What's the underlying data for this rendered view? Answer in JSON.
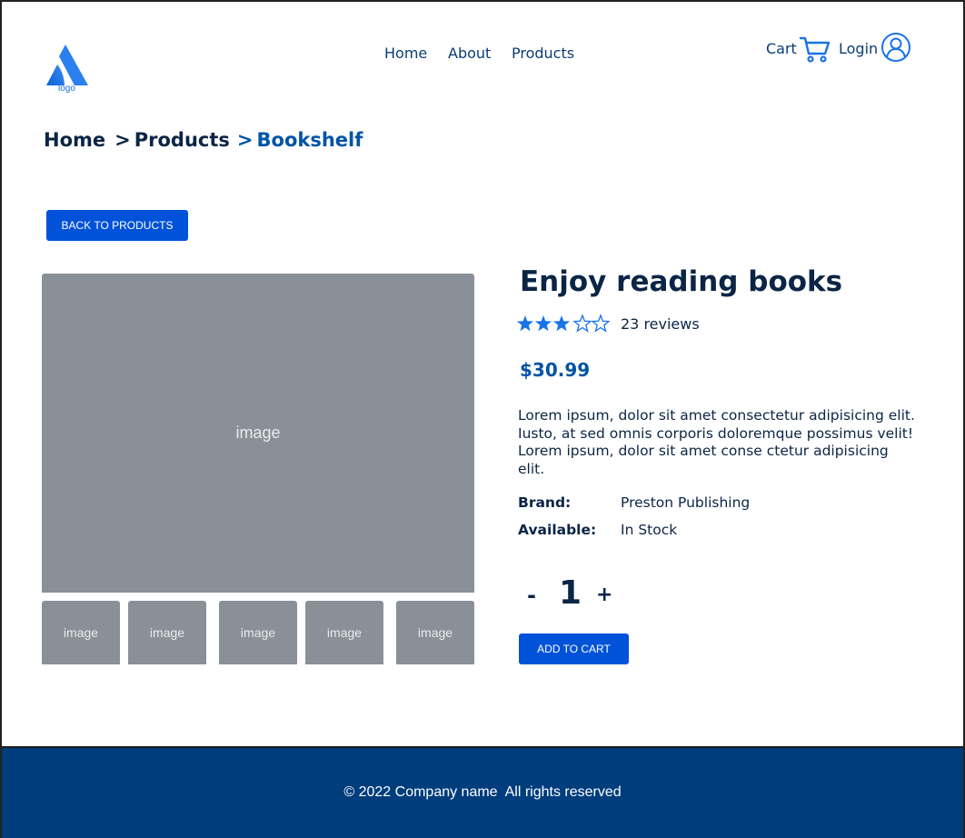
{
  "header": {
    "logo_text": "logo",
    "nav": [
      {
        "label": "Home"
      },
      {
        "label": "About"
      },
      {
        "label": "Products"
      }
    ],
    "cart_label": "Cart",
    "login_label": "Login"
  },
  "breadcrumb": {
    "items": [
      "Home",
      "Products",
      "Bookshelf"
    ],
    "separator": ">"
  },
  "back_button_label": "BACK TO PRODUCTS",
  "gallery": {
    "main_image_label": "image",
    "thumbnails": [
      "image",
      "image",
      "image",
      "image",
      "image"
    ]
  },
  "product": {
    "title": "Enjoy reading books",
    "rating": 3,
    "rating_max": 5,
    "reviews_text": "23 reviews",
    "price": "$30.99",
    "description": "Lorem ipsum, dolor sit amet consectetur adipisicing elit. Iusto, at sed omnis corporis doloremque possimus velit! Lorem ipsum, dolor sit amet conse ctetur adipisicing elit.",
    "brand_label": "Brand:",
    "brand_value": "Preston Publishing",
    "available_label": "Available:",
    "available_value": "In Stock",
    "quantity": "1",
    "qty_minus": "-",
    "qty_plus": "+",
    "add_to_cart_label": "ADD TO CART"
  },
  "footer": {
    "text": "© 2022 Company name  All rights reserved"
  },
  "colors": {
    "accent": "#0052d9",
    "brand_blue": "#0054a6",
    "dark_text": "#0b2545",
    "footer_bg": "#003d7c",
    "placeholder_gray": "#8a9097",
    "star": "#1a73e8"
  },
  "icons": {
    "logo": "atlassian-like-logo",
    "cart": "cart-icon",
    "user": "user-circle-icon",
    "star": "star-icon"
  }
}
